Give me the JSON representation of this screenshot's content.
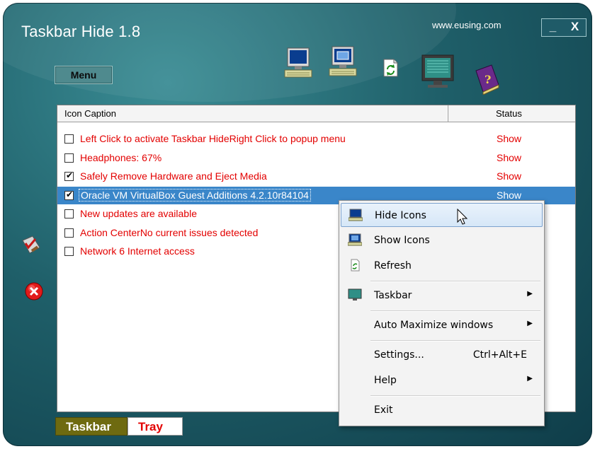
{
  "app": {
    "title": "Taskbar Hide 1.8",
    "website": "www.eusing.com",
    "minimize": "_",
    "close": "X",
    "menu_label": "Menu"
  },
  "toolbar": {
    "icons": [
      "hide-icons-monitor-icon",
      "show-icons-monitor-icon",
      "refresh-icon",
      "taskbar-monitor-icon",
      "help-book-icon"
    ]
  },
  "list": {
    "columns": {
      "caption": "Icon Caption",
      "status": "Status"
    },
    "rows": [
      {
        "checked": false,
        "caption": "Left Click to activate Taskbar HideRight Click to popup menu",
        "status": "Show"
      },
      {
        "checked": false,
        "caption": "Headphones: 67%",
        "status": "Show"
      },
      {
        "checked": true,
        "caption": "Safely Remove Hardware and Eject Media",
        "status": "Show"
      },
      {
        "checked": true,
        "caption": "Oracle VM VirtualBox Guest Additions 4.2.10r84104",
        "status": "Show",
        "selected": true
      },
      {
        "checked": false,
        "caption": "New updates are available",
        "status": ""
      },
      {
        "checked": false,
        "caption": "Action CenterNo current issues detected",
        "status": ""
      },
      {
        "checked": false,
        "caption": "Network  6 Internet access",
        "status": ""
      }
    ]
  },
  "tabs": {
    "taskbar": "Taskbar",
    "tray": "Tray"
  },
  "context_menu": {
    "items": {
      "hide_icons": "Hide Icons",
      "show_icons": "Show Icons",
      "refresh": "Refresh",
      "taskbar": "Taskbar",
      "auto_maximize": "Auto Maximize windows",
      "settings": "Settings...",
      "settings_shortcut": "Ctrl+Alt+E",
      "help": "Help",
      "exit": "Exit"
    }
  },
  "colors": {
    "background": "#1f5f69",
    "row_text": "#e30000",
    "selection": "#3a86c9",
    "taskbar_tab": "#6e6a10"
  }
}
